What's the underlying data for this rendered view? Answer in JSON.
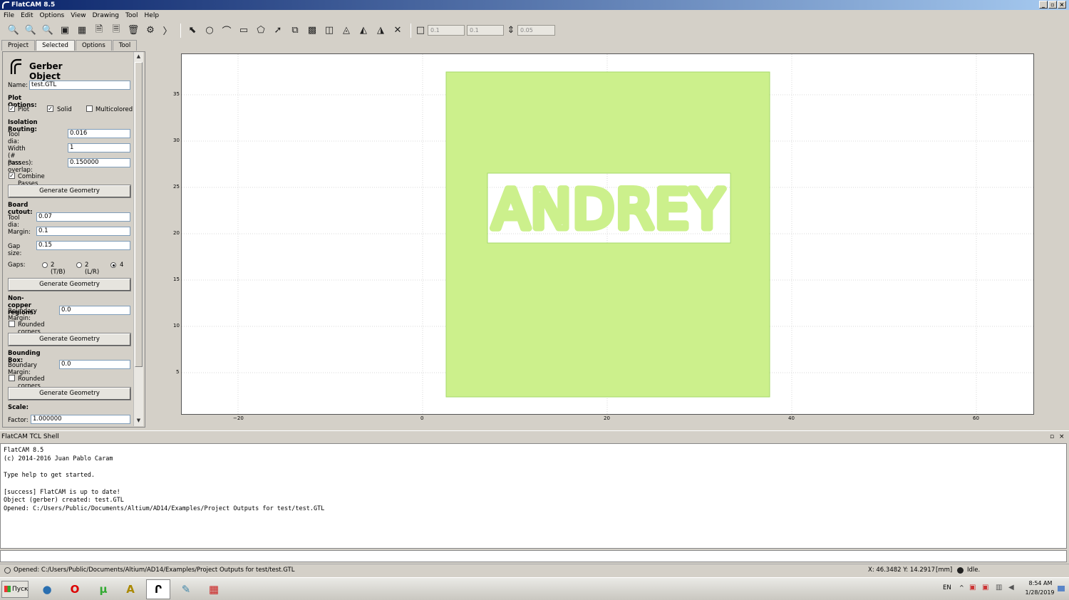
{
  "window": {
    "title": "FlatCAM 8.5"
  },
  "menu": [
    "File",
    "Edit",
    "Options",
    "View",
    "Drawing",
    "Tool",
    "Help"
  ],
  "toolbar": {
    "snap_x": "0.1",
    "snap_y": "0.1",
    "snap_max": "0.05"
  },
  "tabs": [
    "Project",
    "Selected",
    "Options",
    "Tool"
  ],
  "panel": {
    "title": "Gerber Object",
    "name_label": "Name:",
    "name_value": "test.GTL",
    "plot_options": "Plot Options:",
    "plot": "Plot",
    "solid": "Solid",
    "multicolored": "Multicolored",
    "isolation": "Isolation Routing:",
    "tool_dia_label": "Tool dia:",
    "tool_dia": "0.016",
    "width_label": "Width (# passes):",
    "width": "1",
    "overlap_label": "Pass overlap:",
    "overlap": "0.150000",
    "combine": "Combine Passes",
    "gen": "Generate Geometry",
    "cutout": "Board cutout:",
    "cut_tool_label": "Tool dia:",
    "cut_tool": "0.07",
    "margin_label": "Margin:",
    "margin": "0.1",
    "gap_label": "Gap size:",
    "gap": "0.15",
    "gaps_label": "Gaps:",
    "gap_tb": "2 (T/B)",
    "gap_lr": "2 (L/R)",
    "gap_4": "4",
    "noncopper": "Non-copper regions:",
    "boundary_label": "Boundary Margin:",
    "boundary": "0.0",
    "rounded": "Rounded corners",
    "bbox": "Bounding Box:",
    "bbox_boundary": "0.0",
    "scale": "Scale:",
    "factor_label": "Factor:",
    "factor": "1.000000"
  },
  "plot": {
    "board_text": "ANDREY",
    "fill_color": "#ccf08c",
    "stroke_color": "#a6d96a",
    "x_ticks": [
      "−20",
      "0",
      "20",
      "40",
      "60"
    ],
    "y_ticks": [
      "35",
      "30",
      "25",
      "20",
      "15",
      "10",
      "5"
    ]
  },
  "shell": {
    "title": "FlatCAM TCL Shell",
    "lines": [
      "FlatCAM 8.5",
      "(c) 2014-2016 Juan Pablo Caram",
      "",
      "Type help to get started.",
      "",
      "[success] FlatCAM is up to date!",
      "Object (gerber) created: test.GTL",
      "Opened: C:/Users/Public/Documents/Altium/AD14/Examples/Project Outputs for test/test.GTL"
    ]
  },
  "status": {
    "message": "Opened: C:/Users/Public/Documents/Altium/AD14/Examples/Project Outputs for test/test.GTL",
    "coords": "X: 46.3482   Y: 14.2917",
    "units": "[mm]",
    "state": "Idle."
  },
  "taskbar": {
    "start": "Пуск",
    "lang": "EN",
    "time": "8:54 AM",
    "date": "1/28/2019"
  }
}
